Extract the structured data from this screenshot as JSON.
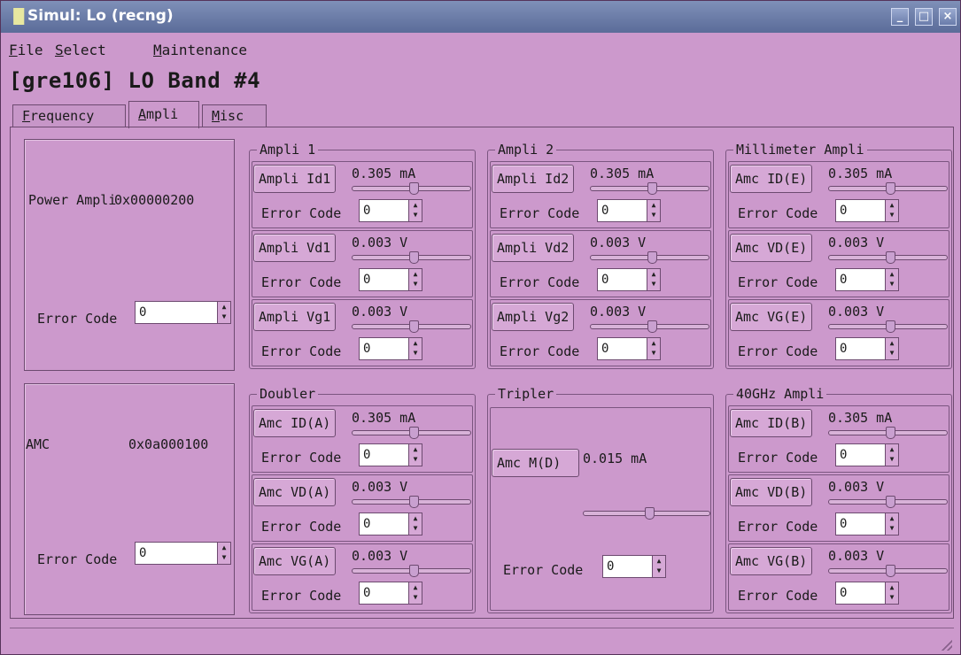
{
  "window": {
    "title": "Simul: Lo (recng)",
    "app_icon": "bars-icon",
    "controls": [
      "_",
      "□",
      "×"
    ]
  },
  "menu": [
    {
      "pre": "",
      "u": "F",
      "post": "ile"
    },
    {
      "pre": "",
      "u": "S",
      "post": "elect"
    },
    {
      "pre": "",
      "u": "M",
      "post": "aintenance"
    }
  ],
  "heading": "[gre106] LO Band #4",
  "tabs": [
    {
      "u": "F",
      "post": "requency"
    },
    {
      "u": "A",
      "post": "mpli"
    },
    {
      "u": "M",
      "post": "isc"
    }
  ],
  "active_tab": "Ampli",
  "error_code_label": "Error Code",
  "power_ampli": {
    "label": "Power Ampli",
    "address": "0x00000200",
    "error_code": "0"
  },
  "amc": {
    "label": "AMC",
    "address": "0x0a000100",
    "error_code": "0"
  },
  "groups": {
    "ampli1": {
      "title": "Ampli 1",
      "rows": [
        {
          "button": "Ampli Id1",
          "value": "0.305 mA",
          "slider": 0.52,
          "error_code": "0"
        },
        {
          "button": "Ampli Vd1",
          "value": "0.003 V",
          "slider": 0.52,
          "error_code": "0"
        },
        {
          "button": "Ampli Vg1",
          "value": "0.003 V",
          "slider": 0.52,
          "error_code": "0"
        }
      ]
    },
    "ampli2": {
      "title": "Ampli 2",
      "rows": [
        {
          "button": "Ampli Id2",
          "value": "0.305 mA",
          "slider": 0.52,
          "error_code": "0"
        },
        {
          "button": "Ampli Vd2",
          "value": "0.003 V",
          "slider": 0.52,
          "error_code": "0"
        },
        {
          "button": "Ampli Vg2",
          "value": "0.003 V",
          "slider": 0.52,
          "error_code": "0"
        }
      ]
    },
    "millimeter": {
      "title": "Millimeter Ampli",
      "rows": [
        {
          "button": "Amc ID(E)",
          "value": "0.305 mA",
          "slider": 0.52,
          "error_code": "0"
        },
        {
          "button": "Amc VD(E)",
          "value": "0.003 V",
          "slider": 0.52,
          "error_code": "0"
        },
        {
          "button": "Amc VG(E)",
          "value": "0.003 V",
          "slider": 0.52,
          "error_code": "0"
        }
      ]
    },
    "doubler": {
      "title": "Doubler",
      "rows": [
        {
          "button": "Amc ID(A)",
          "value": "0.305 mA",
          "slider": 0.52,
          "error_code": "0"
        },
        {
          "button": "Amc VD(A)",
          "value": "0.003 V",
          "slider": 0.52,
          "error_code": "0"
        },
        {
          "button": "Amc VG(A)",
          "value": "0.003 V",
          "slider": 0.52,
          "error_code": "0"
        }
      ]
    },
    "tripler": {
      "title": "Tripler",
      "button": "Amc M(D)",
      "value": "0.015 mA",
      "slider": 0.52,
      "error_code": "0"
    },
    "ghz40": {
      "title": "40GHz Ampli",
      "rows": [
        {
          "button": "Amc ID(B)",
          "value": "0.305 mA",
          "slider": 0.52,
          "error_code": "0"
        },
        {
          "button": "Amc VD(B)",
          "value": "0.003 V",
          "slider": 0.52,
          "error_code": "0"
        },
        {
          "button": "Amc VG(B)",
          "value": "0.003 V",
          "slider": 0.52,
          "error_code": "0"
        }
      ]
    }
  },
  "colors": {
    "background": "#cc99cc",
    "titlebar": "#6b7caa"
  }
}
